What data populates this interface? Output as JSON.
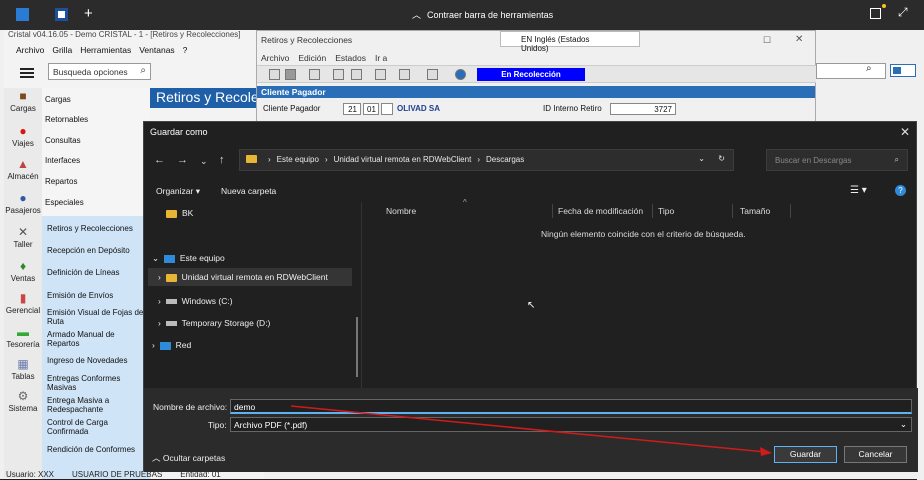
{
  "topbar": {
    "collapse_label": "Contraer barra de herramientas"
  },
  "app": {
    "title": "Cristal v04.16.05 - Demo CRISTAL - 1 - [Retiros y Recolecciones]",
    "menu": [
      "Archivo",
      "Grilla",
      "Herramientas",
      "Ventanas",
      "?"
    ],
    "search_placeholder": "Busqueda opciones"
  },
  "nav": {
    "items": [
      "Cargas",
      "Viajes",
      "Almacén",
      "Pasajeros",
      "Taller",
      "Ventas",
      "Gerencial",
      "Tesorería",
      "Tablas",
      "Sistema"
    ]
  },
  "categories": [
    "Cargas",
    "Retornables",
    "Consultas",
    "Interfaces",
    "Repartos",
    "Especiales"
  ],
  "subitems": [
    "Retiros y Recolecciones",
    "Recepción en Depósito",
    "Definición de Líneas",
    "Emisión de Envíos",
    "Emisión Visual de Fojas de Ruta",
    "Armado Manual de Repartos",
    "Ingreso de Novedades",
    "Entregas Conformes Masivas",
    "Entrega Masiva a Redespachante",
    "Control de Carga Confirmada",
    "Rendición de Conformes"
  ],
  "retiros_title": "Retiros y Recolecciones",
  "mdi": {
    "title": "Retiros y Recolecciones",
    "language": "EN Inglés (Estados Unidos)",
    "menu": [
      "Archivo",
      "Edición",
      "Estados",
      "Ir a"
    ],
    "status": "En Recolección",
    "section": "Cliente Pagador",
    "cliente_label": "Cliente Pagador",
    "cliente_num": "21",
    "cliente_sub": "01",
    "cliente_name": "OLIVAD SA",
    "id_label": "ID Interno Retiro",
    "id_value": "3727"
  },
  "statusbar": {
    "usuario": "Usuario: XXX",
    "usuario_name": "USUARIO DE PRUEBAS",
    "entidad": "Entidad: 01"
  },
  "dialog": {
    "title": "Guardar como",
    "breadcrumb": [
      "Este equipo",
      "Unidad virtual remota en RDWebClient",
      "Descargas"
    ],
    "search_placeholder": "Buscar en Descargas",
    "organize": "Organizar",
    "new_folder": "Nueva carpeta",
    "tree": {
      "bk": "BK",
      "este_equipo": "Este equipo",
      "unidad": "Unidad virtual remota en RDWebClient",
      "windows": "Windows (C:)",
      "temp": "Temporary Storage (D:)",
      "red": "Red"
    },
    "columns": [
      "Nombre",
      "Fecha de modificación",
      "Tipo",
      "Tamaño"
    ],
    "empty_message": "Ningún elemento coincide con el criterio de búsqueda.",
    "filename_label": "Nombre de archivo:",
    "filename_value": "demo",
    "type_label": "Tipo:",
    "type_value": "Archivo PDF (*.pdf)",
    "hide_folders": "Ocultar carpetas",
    "save": "Guardar",
    "cancel": "Cancelar"
  },
  "colors": {
    "accent": "#1f5fa8",
    "status_blue": "#0000ff",
    "annotation_red": "#d11a1a",
    "dialog_bg": "#202020"
  }
}
